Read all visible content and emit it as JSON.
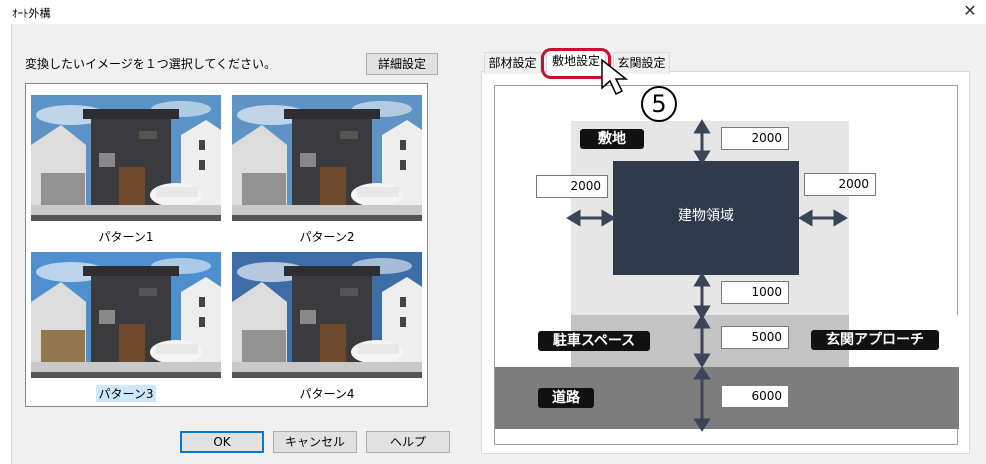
{
  "window": {
    "title": "ｵｰﾄ外構",
    "close_glyph": "✕"
  },
  "left": {
    "prompt": "変換したいイメージを１つ選択してください。",
    "detail_button": "詳細設定",
    "patterns": [
      {
        "label": "パターン1",
        "selected": false
      },
      {
        "label": "パターン2",
        "selected": false
      },
      {
        "label": "パターン3",
        "selected": true
      },
      {
        "label": "パターン4",
        "selected": false
      }
    ]
  },
  "buttons": {
    "ok": "OK",
    "cancel": "キャンセル",
    "help": "ヘルプ"
  },
  "tabs": [
    {
      "label": "部材設定",
      "active": false
    },
    {
      "label": "敷地設定",
      "active": true
    },
    {
      "label": "玄関設定",
      "active": false
    }
  ],
  "callout": {
    "number": "5"
  },
  "site": {
    "site_label": "敷地",
    "building_label": "建物領域",
    "parking_label": "駐車スペース",
    "approach_label": "玄関アプローチ",
    "road_label": "道路",
    "top_value": "2000",
    "left_value": "2000",
    "right_value": "2000",
    "bottom_value": "1000",
    "parking_value": "5000",
    "road_value": "6000"
  },
  "colors": {
    "building": "#2f3a4c",
    "site_bg": "#e6e6e6",
    "parking_bg": "#c3c3c3",
    "road_bg": "#7d7d7d",
    "arrow": "#3a4558",
    "highlight_red": "#c8102e",
    "selected_label_bg": "#cce8ff"
  }
}
